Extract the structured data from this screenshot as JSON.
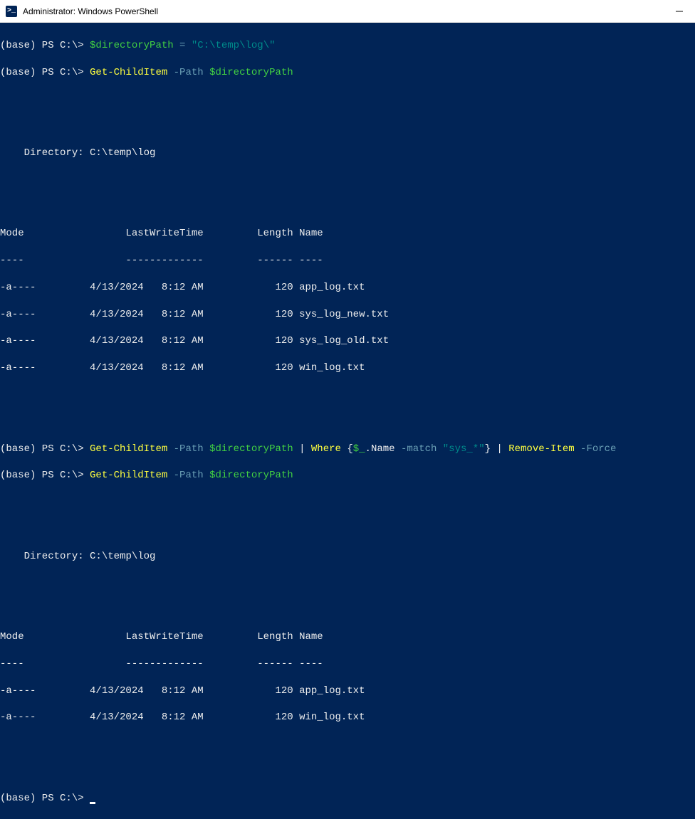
{
  "window": {
    "title": "Administrator: Windows PowerShell",
    "icon_text": ">_"
  },
  "prompt": {
    "prefix": "(base) PS C:\\> "
  },
  "cmd1": {
    "var": "$directoryPath",
    "eq": " = ",
    "value": "\"C:\\temp\\log\\\""
  },
  "cmd2": {
    "cmdlet": "Get-ChildItem",
    "param": " -Path ",
    "arg": "$directoryPath"
  },
  "dir1": {
    "label": "    Directory: ",
    "path": "C:\\temp\\log"
  },
  "header1": {
    "line": "Mode                 LastWriteTime         Length Name",
    "rule": "----                 -------------         ------ ----"
  },
  "rows1": {
    "r0": "-a----         4/13/2024   8:12 AM            120 app_log.txt",
    "r1": "-a----         4/13/2024   8:12 AM            120 sys_log_new.txt",
    "r2": "-a----         4/13/2024   8:12 AM            120 sys_log_old.txt",
    "r3": "-a----         4/13/2024   8:12 AM            120 win_log.txt"
  },
  "cmd3": {
    "cmdlet": "Get-ChildItem",
    "param": " -Path ",
    "arg": "$directoryPath",
    "pipe1": " | ",
    "where": "Where",
    "brace_open": " {",
    "dollar_under": "$_",
    "dot_name": ".Name",
    "match": " -match ",
    "pattern": "\"sys_*\"",
    "brace_close": "}",
    "pipe2": " | ",
    "remove": "Remove-Item",
    "force": " -Force"
  },
  "cmd4": {
    "cmdlet": "Get-ChildItem",
    "param": " -Path ",
    "arg": "$directoryPath"
  },
  "dir2": {
    "label": "    Directory: ",
    "path": "C:\\temp\\log"
  },
  "header2": {
    "line": "Mode                 LastWriteTime         Length Name",
    "rule": "----                 -------------         ------ ----"
  },
  "rows2": {
    "r0": "-a----         4/13/2024   8:12 AM            120 app_log.txt",
    "r1": "-a----         4/13/2024   8:12 AM            120 win_log.txt"
  }
}
